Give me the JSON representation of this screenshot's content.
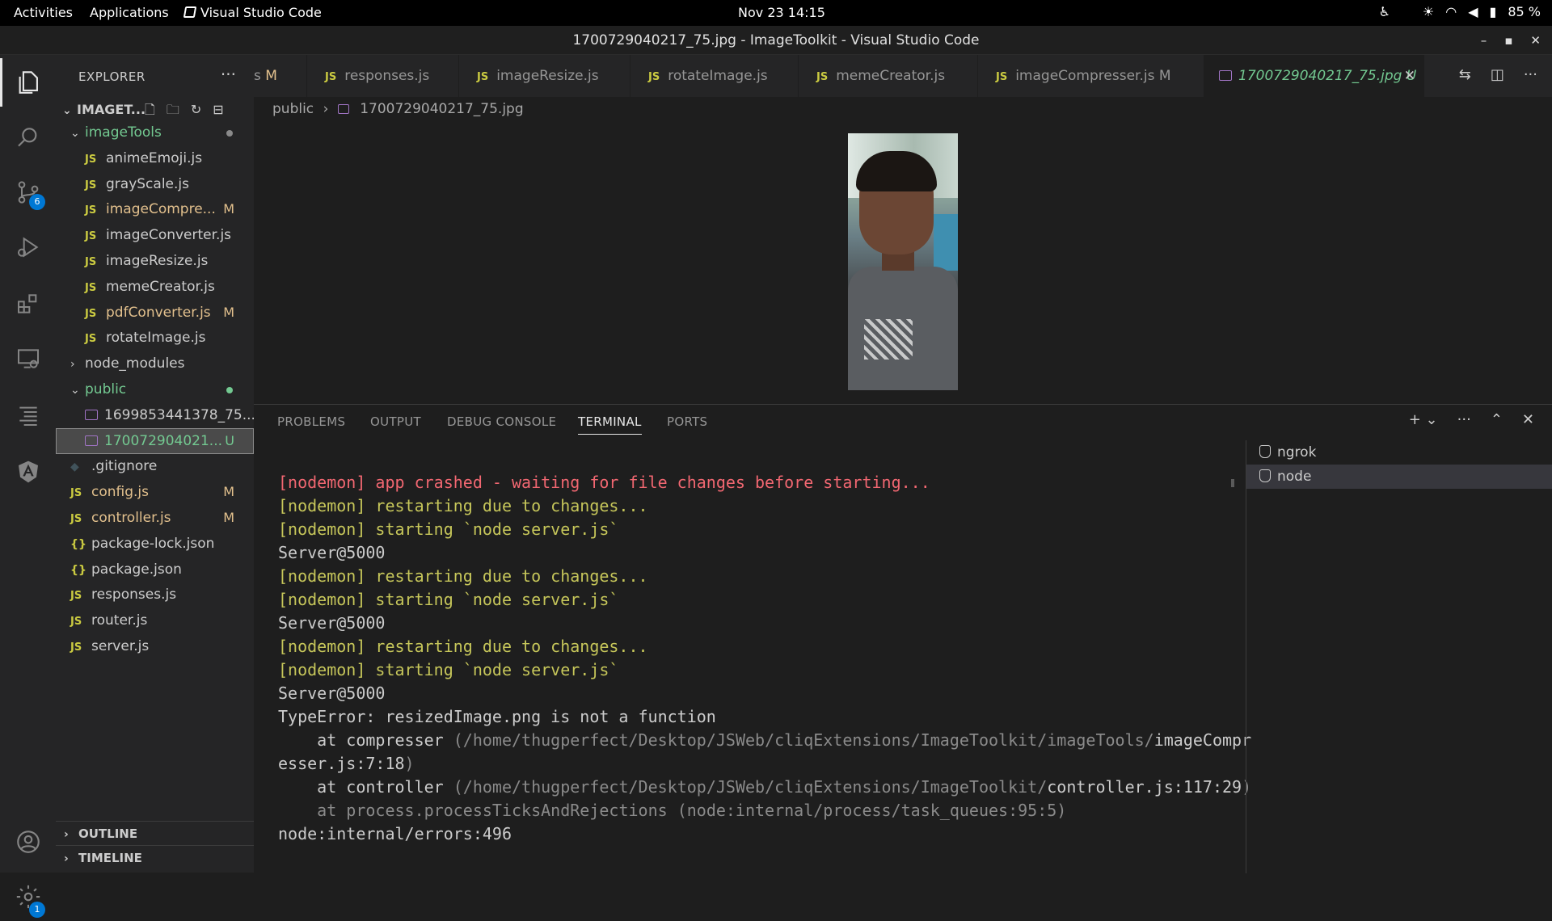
{
  "topbar": {
    "activities": "Activities",
    "applications": "Applications",
    "app_name": "Visual Studio Code",
    "clock": "Nov 23  14:15",
    "battery": "85 %"
  },
  "window": {
    "title": "1700729040217_75.jpg - ImageToolkit - Visual Studio Code"
  },
  "activitybar": {
    "scm_badge": "6",
    "settings_badge": "1"
  },
  "explorer": {
    "header": "EXPLORER",
    "root": "IMAGET...",
    "items": [
      {
        "label": "imageTools",
        "type": "folder-open",
        "status": ""
      },
      {
        "label": "animeEmoji.js",
        "type": "js",
        "status": ""
      },
      {
        "label": "grayScale.js",
        "type": "js",
        "status": ""
      },
      {
        "label": "imageCompre...",
        "type": "js",
        "status": "M"
      },
      {
        "label": "imageConverter.js",
        "type": "js",
        "status": ""
      },
      {
        "label": "imageResize.js",
        "type": "js",
        "status": ""
      },
      {
        "label": "memeCreator.js",
        "type": "js",
        "status": ""
      },
      {
        "label": "pdfConverter.js",
        "type": "js",
        "status": "M"
      },
      {
        "label": "rotateImage.js",
        "type": "js",
        "status": ""
      },
      {
        "label": "node_modules",
        "type": "folder-closed",
        "status": ""
      },
      {
        "label": "public",
        "type": "folder-open",
        "status": ""
      },
      {
        "label": "1699853441378_75....",
        "type": "image",
        "status": ""
      },
      {
        "label": "170072904021...",
        "type": "image",
        "status": "U"
      },
      {
        "label": ".gitignore",
        "type": "git",
        "status": ""
      },
      {
        "label": "config.js",
        "type": "js",
        "status": "M"
      },
      {
        "label": "controller.js",
        "type": "js",
        "status": "M"
      },
      {
        "label": "package-lock.json",
        "type": "json",
        "status": ""
      },
      {
        "label": "package.json",
        "type": "json",
        "status": ""
      },
      {
        "label": "responses.js",
        "type": "js",
        "status": ""
      },
      {
        "label": "router.js",
        "type": "js",
        "status": ""
      },
      {
        "label": "server.js",
        "type": "js",
        "status": ""
      }
    ],
    "outline": "OUTLINE",
    "timeline": "TIMELINE"
  },
  "tabs": [
    {
      "label": "s",
      "status": "M"
    },
    {
      "label": "responses.js",
      "status": ""
    },
    {
      "label": "imageResize.js",
      "status": ""
    },
    {
      "label": "rotateImage.js",
      "status": ""
    },
    {
      "label": "memeCreator.js",
      "status": ""
    },
    {
      "label": "imageCompresser.js",
      "status": "M"
    },
    {
      "label": "1700729040217_75.jpg",
      "status": "U"
    }
  ],
  "breadcrumb": {
    "folder": "public",
    "file": "1700729040217_75.jpg"
  },
  "panel": {
    "tabs": [
      "PROBLEMS",
      "OUTPUT",
      "DEBUG CONSOLE",
      "TERMINAL",
      "PORTS"
    ],
    "active_tab": "TERMINAL",
    "terminals": [
      "ngrok",
      "node"
    ],
    "lines": [
      {
        "text": "[nodemon] app crashed - waiting for file changes before starting...",
        "style": "red"
      },
      {
        "text": "[nodemon] restarting due to changes...",
        "style": "yellow"
      },
      {
        "text": "[nodemon] starting `node server.js`",
        "style": "yellow"
      },
      {
        "text": "Server@5000",
        "style": "plain"
      },
      {
        "text": "[nodemon] restarting due to changes...",
        "style": "yellow"
      },
      {
        "text": "[nodemon] starting `node server.js`",
        "style": "yellow"
      },
      {
        "text": "Server@5000",
        "style": "plain"
      },
      {
        "text": "[nodemon] restarting due to changes...",
        "style": "yellow"
      },
      {
        "text": "[nodemon] starting `node server.js`",
        "style": "yellow"
      },
      {
        "text": "Server@5000",
        "style": "plain"
      },
      {
        "text": "TypeError: resizedImage.png is not a function",
        "style": "plain"
      },
      {
        "text": "    at compresser (/home/thugperfect/Desktop/JSWeb/cliqExtensions/ImageToolkit/imageTools/imageCompresser.js:7:18)",
        "style": "trace"
      },
      {
        "text": "    at controller (/home/thugperfect/Desktop/JSWeb/cliqExtensions/ImageToolkit/controller.js:117:29)",
        "style": "trace"
      },
      {
        "text": "    at process.processTicksAndRejections (node:internal/process/task_queues:95:5)",
        "style": "gray"
      },
      {
        "text": "node:internal/errors:496",
        "style": "plain"
      }
    ]
  },
  "colors": {
    "js_icon": "#cbcb41",
    "modified": "#e2c08d",
    "untracked": "#73c991",
    "terminal_red": "#f16771",
    "terminal_yellow": "#c6c65a"
  }
}
